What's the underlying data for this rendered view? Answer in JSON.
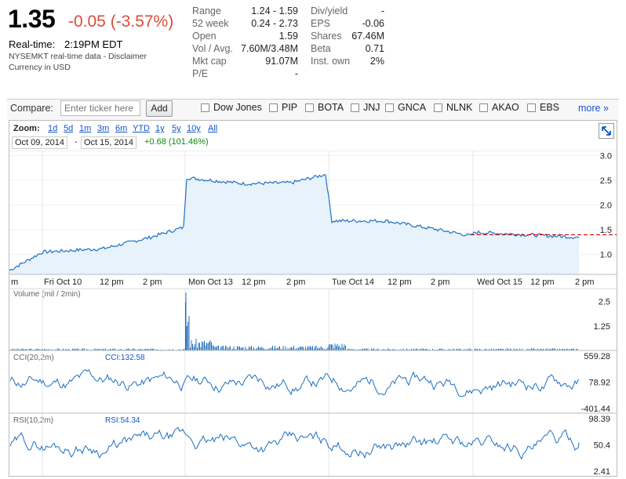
{
  "quote": {
    "price": "1.35",
    "change": "-0.05 (-3.57%)",
    "realtime_label": "Real-time:",
    "realtime_time": "2:19PM EDT",
    "data_note": "NYSEMKT real-time data - Disclaimer",
    "currency_note": "Currency in USD"
  },
  "stats_left": [
    {
      "label": "Range",
      "value": "1.24 - 1.59"
    },
    {
      "label": "52 week",
      "value": "0.24 - 2.73"
    },
    {
      "label": "Open",
      "value": "1.59"
    },
    {
      "label": "Vol / Avg.",
      "value": "7.60M/3.48M"
    },
    {
      "label": "Mkt cap",
      "value": "91.07M"
    },
    {
      "label": "P/E",
      "value": "-"
    }
  ],
  "stats_right": [
    {
      "label": "Div/yield",
      "value": "-"
    },
    {
      "label": "EPS",
      "value": "-0.06"
    },
    {
      "label": "Shares",
      "value": "67.46M"
    },
    {
      "label": "Beta",
      "value": "0.71"
    },
    {
      "label": "Inst. own",
      "value": "2%"
    }
  ],
  "compare": {
    "label": "Compare:",
    "placeholder": "Enter ticker here",
    "add_label": "Add",
    "tickers": [
      "Dow Jones",
      "PIP",
      "BOTA",
      "JNJ",
      "GNCA",
      "NLNK",
      "AKAO",
      "EBS"
    ],
    "more_label": "more »"
  },
  "chart": {
    "zoom_label": "Zoom:",
    "zoom_options": [
      "1d",
      "5d",
      "1m",
      "3m",
      "6m",
      "YTD",
      "1y",
      "5y",
      "10y",
      "All"
    ],
    "date_from": "Oct 09, 2014",
    "date_sep": "-",
    "date_to": "Oct 15, 2014",
    "period_change": "+0.68 (101.46%)",
    "expand_icon": "expand-icon",
    "x_ticks": [
      "m",
      "Fri Oct 10",
      "12 pm",
      "2 pm",
      "Mon Oct 13",
      "12 pm",
      "2 pm",
      "Tue Oct 14",
      "12 pm",
      "2 pm",
      "Wed Oct 15",
      "12 pm",
      "2 pm"
    ],
    "volume_label": "Volume (mil / 2min)",
    "cci_label": "CCI(20,2m)",
    "cci_value": "CCI:132.58",
    "rsi_label": "RSI(10,2m)",
    "rsi_value": "RSI:54.34",
    "colors": {
      "line": "#1f6fc2",
      "fill": "#e8f2fb",
      "prev_close": "#cc0000",
      "down": "#dd4b39",
      "up": "#0a8a0a"
    }
  },
  "chart_data": [
    {
      "type": "area",
      "title": "",
      "ylim": [
        0.6,
        3.1
      ],
      "y_ticks": [
        "3.0",
        "2.5",
        "2.0",
        "1.5",
        "1.0"
      ],
      "previous_close": 1.4,
      "x": [
        "Oct 9 close",
        "Fri Oct 10 open",
        "Fri Oct 10 12 pm",
        "Fri Oct 10 2 pm",
        "Fri Oct 10 close",
        "Mon Oct 13 open",
        "Mon Oct 13 12 pm",
        "Mon Oct 13 2 pm",
        "Mon Oct 13 close",
        "Tue Oct 14 open",
        "Tue Oct 14 12 pm",
        "Tue Oct 14 2 pm",
        "Tue Oct 14 close",
        "Wed Oct 15 open",
        "Wed Oct 15 12 pm",
        "Wed Oct 15 2 pm",
        "Wed Oct 15 last"
      ],
      "series": [
        {
          "values": [
            0.68,
            1.05,
            1.12,
            1.35,
            1.55,
            2.55,
            2.43,
            2.45,
            2.62,
            1.68,
            1.68,
            1.52,
            1.38,
            1.45,
            1.4,
            1.37,
            1.35
          ]
        }
      ]
    },
    {
      "type": "bar",
      "title": "Volume (mil / 2min)",
      "y_ticks": [
        "2.5",
        "1.25"
      ],
      "ylim": [
        0,
        3.0
      ]
    },
    {
      "type": "line",
      "title": "CCI(20,2m)",
      "y_ticks": [
        "559.28",
        "78.92",
        "-401.44"
      ],
      "ylim": [
        -401.44,
        559.28
      ],
      "last": 132.58
    },
    {
      "type": "line",
      "title": "RSI(10,2m)",
      "y_ticks": [
        "98.39",
        "50.4",
        "2.41"
      ],
      "ylim": [
        2.41,
        98.39
      ],
      "last": 54.34
    }
  ]
}
